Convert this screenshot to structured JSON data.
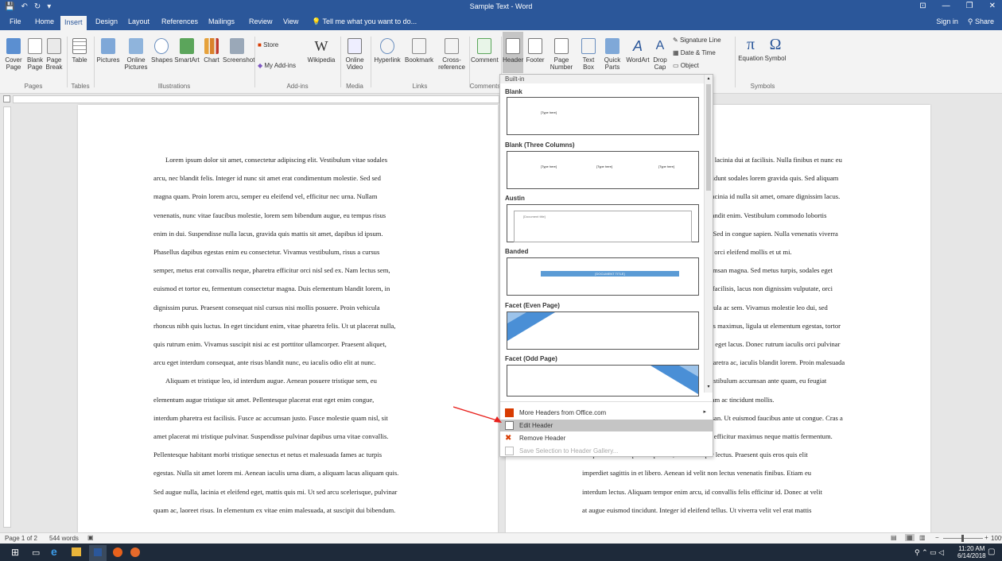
{
  "window": {
    "title": "Sample Text - Word"
  },
  "qat": {
    "save": "💾",
    "undo": "↶",
    "redo": "↻",
    "more": "▾"
  },
  "window_controls": {
    "ribbon_display": "⊡",
    "minimize": "—",
    "restore": "❐",
    "close": "✕"
  },
  "tabs": [
    "File",
    "Home",
    "Insert",
    "Design",
    "Layout",
    "References",
    "Mailings",
    "Review",
    "View"
  ],
  "tell_me": "Tell me what you want to do...",
  "account": {
    "sign_in": "Sign in",
    "share": "Share"
  },
  "ribbon": {
    "buttons": {
      "cover_page": "Cover Page",
      "blank_page": "Blank Page",
      "page_break": "Page Break",
      "table": "Table",
      "pictures": "Pictures",
      "online_pictures": "Online Pictures",
      "shapes": "Shapes",
      "smartart": "SmartArt",
      "chart": "Chart",
      "screenshot": "Screenshot",
      "store": "Store",
      "my_addins": "My Add-ins",
      "wikipedia": "Wikipedia",
      "online_video": "Online Video",
      "hyperlink": "Hyperlink",
      "bookmark": "Bookmark",
      "cross_reference": "Cross-reference",
      "comment": "Comment",
      "header": "Header",
      "footer": "Footer",
      "page_number": "Page Number",
      "text_box": "Text Box",
      "quick_parts": "Quick Parts",
      "wordart": "WordArt",
      "drop_cap": "Drop Cap",
      "signature_line": "Signature Line",
      "date_time": "Date & Time",
      "object": "Object",
      "equation": "Equation",
      "symbol": "Symbol"
    },
    "groups": {
      "pages": "Pages",
      "tables": "Tables",
      "illustrations": "Illustrations",
      "addins": "Add-ins",
      "media": "Media",
      "links": "Links",
      "comments": "Comments",
      "symbols": "Symbols"
    }
  },
  "header_gallery": {
    "category": "Built-in",
    "items": [
      {
        "name": "Blank",
        "placeholder": "[Type here]"
      },
      {
        "name": "Blank (Three Columns)",
        "placeholders": [
          "[Type here]",
          "[Type here]",
          "[Type here]"
        ]
      },
      {
        "name": "Austin",
        "placeholder": "[Document title]"
      },
      {
        "name": "Banded",
        "placeholder": "[DOCUMENT TITLE]"
      },
      {
        "name": "Facet (Even Page)"
      },
      {
        "name": "Facet (Odd Page)"
      }
    ],
    "menu": [
      {
        "label": "More Headers from Office.com",
        "icon": "office-icon",
        "submenu": true
      },
      {
        "label": "Edit Header",
        "icon": "edit-header-icon",
        "highlighted": true
      },
      {
        "label": "Remove Header",
        "icon": "remove-header-icon"
      },
      {
        "label": "Save Selection to Header Gallery...",
        "icon": "save-gallery-icon",
        "disabled": true
      }
    ]
  },
  "document": {
    "left_lines": [
      "Lorem ipsum dolor sit amet, consectetur adipiscing elit. Vestibulum vitae sodales",
      "arcu, nec blandit felis. Integer id nunc sit amet erat condimentum molestie. Sed sed",
      "magna quam. Proin lorem arcu, semper eu eleifend vel, efficitur nec urna. Nullam",
      "venenatis, nunc vitae faucibus molestie, lorem sem bibendum augue, eu tempus risus",
      "enim in dui. Suspendisse nulla lacus, gravida quis mattis sit amet, dapibus id ipsum.",
      "Phasellus dapibus egestas enim eu consectetur. Vivamus vestibulum, risus a cursus",
      "semper, metus erat convallis neque, pharetra efficitur orci nisl sed ex. Nam lectus sem,",
      "euismod et tortor eu, fermentum consectetur magna. Duis elementum blandit lorem, in",
      "dignissim purus. Praesent consequat nisl cursus nisi mollis posuere. Proin vehicula",
      "rhoncus nibh quis luctus. In eget tincidunt enim, vitae pharetra felis. Ut ut placerat nulla,",
      "quis rutrum enim. Vivamus suscipit nisi ac est porttitor ullamcorper. Praesent aliquet,",
      "arcu eget interdum consequat, ante risus blandit nunc, eu iaculis odio elit at nunc.",
      "Aliquam et tristique leo, id interdum augue. Aenean posuere tristique sem, eu",
      "elementum augue tristique sit amet. Pellentesque placerat erat eget enim congue,",
      "interdum pharetra est facilisis. Fusce ac accumsan justo. Fusce molestie quam nisl, sit",
      "amet placerat mi tristique pulvinar. Suspendisse pulvinar dapibus urna vitae convallis.",
      "Pellentesque habitant morbi tristique senectus et netus et malesuada fames ac turpis",
      "egestas. Nulla sit amet lorem mi. Aenean iaculis urna diam, a aliquam lacus aliquam quis.",
      "Sed augue nulla, lacinia et eleifend eget, mattis quis mi. Ut sed arcu scelerisque, pulvinar",
      "quam ac, laoreet risus. In elementum ex vitae enim malesuada, at suscipit dui bibendum."
    ],
    "right_lines": [
      "iat lacinia dui at facilisis. Nulla finibus et nunc eu",
      "acidunt sodales lorem gravida quis. Sed aliquam",
      ", lacinia id nulla sit amet, ornare dignissim lacus.",
      "blandit enim. Vestibulum commodo lobortis",
      "d. Sed in congue sapien. Nulla venenatis viverra",
      "eu orci eleifend mollis et ut mi.",
      "cumsan magna. Sed metus turpis, sodales eget",
      "Jt facilisis, lacus non dignissim vulputate, orci",
      "ligula ac sem. Vivamus molestie leo dui, sed",
      "nus maximus, ligula ut elementum egestas, tortor",
      "mi eget lacus. Donec rutrum iaculis orci pulvinar",
      "pharetra ac, iaculis blandit lorem. Proin malesuada",
      "Vestibulum accumsan ante quam, eu feugiat",
      "diam ac tincidunt mollis.",
      "msan. Ut euismod faucibus ante ut congue. Cras a",
      "us efficitur maximus neque mattis fermentum.",
      "Aliquam ullamcorper semper dui, a ullamcorper lectus. Praesent quis eros quis elit",
      "imperdiet sagittis in et libero. Aenean id velit non lectus venenatis finibus. Etiam eu",
      "interdum lectus. Aliquam tempor enim arcu, id convallis felis efficitur id. Donec at velit",
      "at augue euismod tincidunt. Integer id eleifend tellus. Ut viverra velit vel erat mattis"
    ]
  },
  "status": {
    "page": "Page 1 of 2",
    "words": "544 words",
    "zoom": "100%"
  },
  "taskbar": {
    "time": "11:20 AM",
    "date": "6/14/2018"
  },
  "colors": {
    "word_blue": "#2b579a",
    "highlight": "#c5c5c5",
    "arrow": "#e8201c"
  }
}
